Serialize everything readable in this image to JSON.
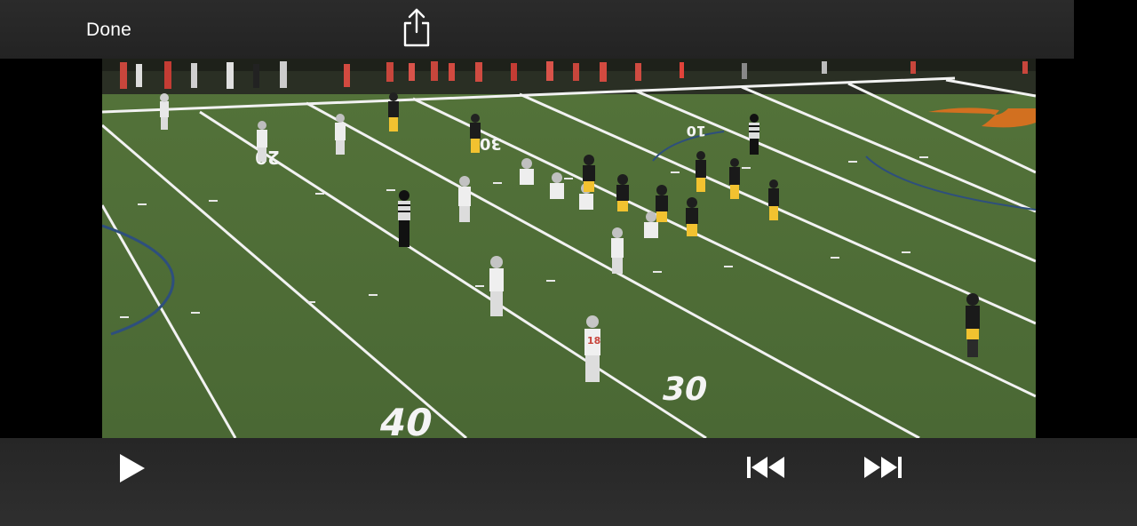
{
  "top_bar": {
    "done_label": "Done",
    "share_icon": "share-icon"
  },
  "video": {
    "yard_numbers": {
      "far_20": "20",
      "far_30": "30",
      "far_10": "10",
      "near_30": "30",
      "near_40": "40"
    },
    "jersey_number": "18"
  },
  "playback_controls": {
    "play_icon": "play-icon",
    "skip_back_icon": "skip-back-icon",
    "skip_forward_icon": "skip-forward-icon"
  },
  "colors": {
    "turf": "#4f6e38",
    "bar": "#282828",
    "home_uniform": "#f2c230",
    "away_uniform": "#e8e8e8",
    "end_zone_logo": "#e0701e"
  }
}
